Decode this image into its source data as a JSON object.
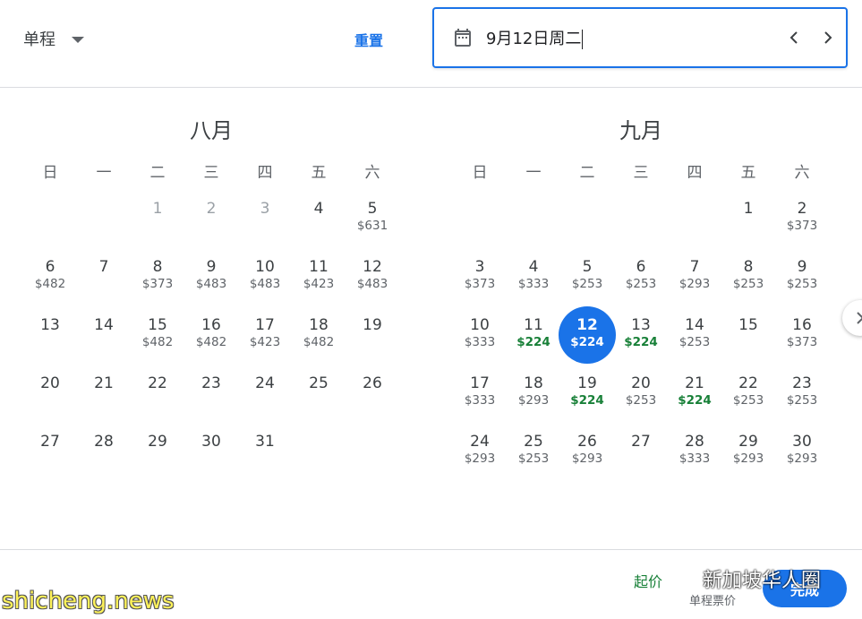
{
  "header": {
    "trip_type": "单程",
    "reset_label": "重置",
    "date_value": "9月12日周二"
  },
  "august": {
    "title": "八月",
    "weekdays": [
      "日",
      "一",
      "二",
      "三",
      "四",
      "五",
      "六"
    ],
    "days": [
      {
        "n": "",
        "p": ""
      },
      {
        "n": "",
        "p": ""
      },
      {
        "n": "1",
        "p": "",
        "s": "past"
      },
      {
        "n": "2",
        "p": "",
        "s": "past"
      },
      {
        "n": "3",
        "p": "",
        "s": "past"
      },
      {
        "n": "4",
        "p": ""
      },
      {
        "n": "5",
        "p": "$631"
      },
      {
        "n": "6",
        "p": "$482"
      },
      {
        "n": "7",
        "p": ""
      },
      {
        "n": "8",
        "p": "$373"
      },
      {
        "n": "9",
        "p": "$483"
      },
      {
        "n": "10",
        "p": "$483"
      },
      {
        "n": "11",
        "p": "$423"
      },
      {
        "n": "12",
        "p": "$483"
      },
      {
        "n": "13",
        "p": ""
      },
      {
        "n": "14",
        "p": ""
      },
      {
        "n": "15",
        "p": "$482"
      },
      {
        "n": "16",
        "p": "$482"
      },
      {
        "n": "17",
        "p": "$423"
      },
      {
        "n": "18",
        "p": "$482"
      },
      {
        "n": "19",
        "p": ""
      },
      {
        "n": "20",
        "p": ""
      },
      {
        "n": "21",
        "p": ""
      },
      {
        "n": "22",
        "p": ""
      },
      {
        "n": "23",
        "p": ""
      },
      {
        "n": "24",
        "p": ""
      },
      {
        "n": "25",
        "p": ""
      },
      {
        "n": "26",
        "p": ""
      },
      {
        "n": "27",
        "p": ""
      },
      {
        "n": "28",
        "p": ""
      },
      {
        "n": "29",
        "p": ""
      },
      {
        "n": "30",
        "p": ""
      },
      {
        "n": "31",
        "p": ""
      }
    ]
  },
  "september": {
    "title": "九月",
    "weekdays": [
      "日",
      "一",
      "二",
      "三",
      "四",
      "五",
      "六"
    ],
    "days": [
      {
        "n": "",
        "p": ""
      },
      {
        "n": "",
        "p": ""
      },
      {
        "n": "",
        "p": ""
      },
      {
        "n": "",
        "p": ""
      },
      {
        "n": "",
        "p": ""
      },
      {
        "n": "1",
        "p": ""
      },
      {
        "n": "2",
        "p": "$373"
      },
      {
        "n": "3",
        "p": "$373"
      },
      {
        "n": "4",
        "p": "$333"
      },
      {
        "n": "5",
        "p": "$253"
      },
      {
        "n": "6",
        "p": "$253"
      },
      {
        "n": "7",
        "p": "$293"
      },
      {
        "n": "8",
        "p": "$253"
      },
      {
        "n": "9",
        "p": "$253"
      },
      {
        "n": "10",
        "p": "$333"
      },
      {
        "n": "11",
        "p": "$224",
        "s": "low"
      },
      {
        "n": "12",
        "p": "$224",
        "s": "selected"
      },
      {
        "n": "13",
        "p": "$224",
        "s": "low"
      },
      {
        "n": "14",
        "p": "$253"
      },
      {
        "n": "15",
        "p": ""
      },
      {
        "n": "16",
        "p": "$373"
      },
      {
        "n": "17",
        "p": "$333"
      },
      {
        "n": "18",
        "p": "$293"
      },
      {
        "n": "19",
        "p": "$224",
        "s": "low"
      },
      {
        "n": "20",
        "p": "$253"
      },
      {
        "n": "21",
        "p": "$224",
        "s": "low"
      },
      {
        "n": "22",
        "p": "$253"
      },
      {
        "n": "23",
        "p": "$253"
      },
      {
        "n": "24",
        "p": "$293"
      },
      {
        "n": "25",
        "p": "$253"
      },
      {
        "n": "26",
        "p": "$293"
      },
      {
        "n": "27",
        "p": ""
      },
      {
        "n": "28",
        "p": "$333"
      },
      {
        "n": "29",
        "p": "$293"
      },
      {
        "n": "30",
        "p": "$293"
      }
    ]
  },
  "footer": {
    "from_label": "起价",
    "oneway_label": "单程票价",
    "done_label": "完成"
  },
  "watermarks": {
    "wechat": "新加坡华人圈",
    "site": "shicheng.news"
  },
  "colors": {
    "accent": "#1a73e8",
    "low_price": "#188038"
  },
  "icons": {
    "calendar": "calendar-icon",
    "prev": "chevron-left-icon",
    "next": "chevron-right-icon",
    "side": "chevron-right-icon"
  }
}
